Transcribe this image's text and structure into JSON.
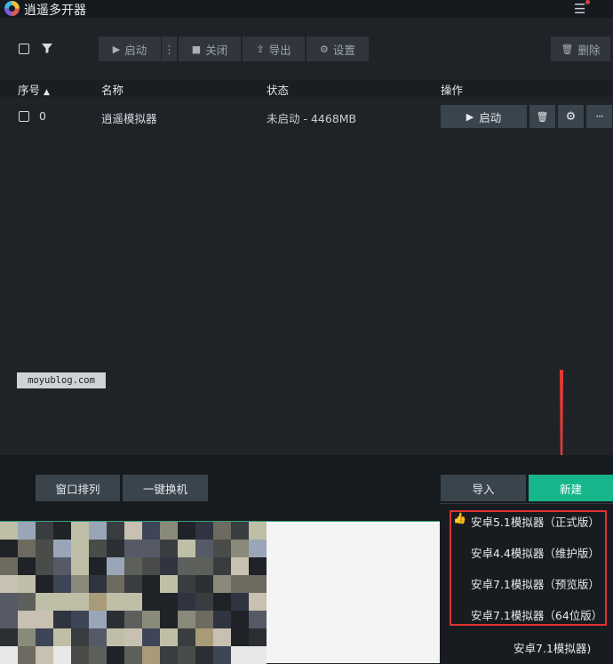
{
  "app": {
    "title": "逍遥多开器"
  },
  "toolbar": {
    "start_label": "启动",
    "close_label": "关闭",
    "export_label": "导出",
    "settings_label": "设置",
    "delete_label": "删除"
  },
  "table": {
    "headers": {
      "index": "序号",
      "name": "名称",
      "status": "状态",
      "actions": "操作"
    },
    "rows": [
      {
        "index": "0",
        "name": "逍遥模拟器",
        "status": "未启动 - 4468MB",
        "start_label": "启动"
      }
    ]
  },
  "watermark": "moyublog.com",
  "bottom": {
    "arrange_label": "窗口排列",
    "switch_label": "一键换机",
    "import_label": "导入",
    "new_label": "新建"
  },
  "dropdown": {
    "items": [
      {
        "label": "安卓5.1模拟器（正式版）",
        "recommended": true
      },
      {
        "label": "安卓4.4模拟器（维护版）"
      },
      {
        "label": "安卓7.1模拟器（预览版）"
      },
      {
        "label": "安卓7.1模拟器（64位版）"
      }
    ],
    "partial_label": "安卓7.1模拟器)"
  },
  "colors": {
    "accent_green": "#17b58c",
    "highlight_red": "#e03030"
  }
}
